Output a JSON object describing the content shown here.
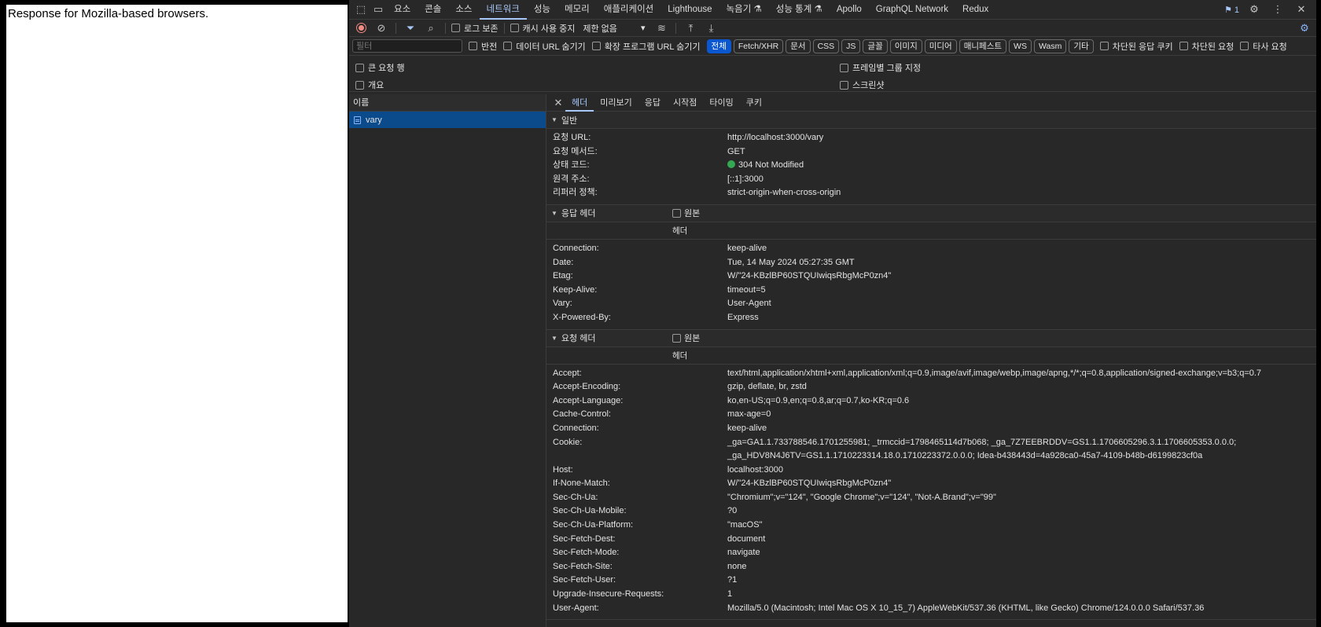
{
  "page": {
    "text": "Response for Mozilla-based browsers."
  },
  "tabs": [
    "요소",
    "콘솔",
    "소스",
    "네트워크",
    "성능",
    "메모리",
    "애플리케이션",
    "Lighthouse",
    "녹음기 ⚗",
    "성능 통계 ⚗",
    "Apollo",
    "GraphQL Network",
    "Redux"
  ],
  "active_tab": "네트워크",
  "issues_badge": "1",
  "toolbar": {
    "preserve_log": "로그 보존",
    "disable_cache": "캐시 사용 중지",
    "throttle": "제한 없음"
  },
  "filter": {
    "placeholder": "필터",
    "invert": "반전",
    "hide_data_urls": "데이터 URL 숨기기",
    "hide_ext_urls": "확장 프로그램 URL 숨기기",
    "types": [
      "전체",
      "Fetch/XHR",
      "문서",
      "CSS",
      "JS",
      "글꼴",
      "이미지",
      "미디어",
      "매니페스트",
      "WS",
      "Wasm",
      "기타"
    ],
    "blocked_cookies": "차단된 응답 쿠키",
    "blocked_requests": "차단된 요청",
    "third_party": "타사 요청"
  },
  "options": {
    "big_rows": "큰 요청 행",
    "group_by_frame": "프레임별 그룹 지정",
    "overview": "개요",
    "screenshots": "스크린샷"
  },
  "namelist": {
    "header": "이름",
    "items": [
      "vary"
    ]
  },
  "detail_tabs": [
    "헤더",
    "미리보기",
    "응답",
    "시작점",
    "타이밍",
    "쿠키"
  ],
  "general": {
    "title": "일반",
    "rows": [
      {
        "k": "요청 URL:",
        "v": "http://localhost:3000/vary"
      },
      {
        "k": "요청 메서드:",
        "v": "GET"
      },
      {
        "k": "상태 코드:",
        "v": "304 Not Modified"
      },
      {
        "k": "원격 주소:",
        "v": "[::1]:3000"
      },
      {
        "k": "리퍼러 정책:",
        "v": "strict-origin-when-cross-origin"
      }
    ]
  },
  "response_headers": {
    "title": "응답 헤더",
    "raw_label": "원본",
    "sub": "헤더",
    "rows": [
      {
        "k": "Connection:",
        "v": "keep-alive"
      },
      {
        "k": "Date:",
        "v": "Tue, 14 May 2024 05:27:35 GMT"
      },
      {
        "k": "Etag:",
        "v": "W/\"24-KBzlBP60STQUIwiqsRbgMcP0zn4\""
      },
      {
        "k": "Keep-Alive:",
        "v": "timeout=5"
      },
      {
        "k": "Vary:",
        "v": "User-Agent"
      },
      {
        "k": "X-Powered-By:",
        "v": "Express"
      }
    ]
  },
  "request_headers": {
    "title": "요청 헤더",
    "raw_label": "원본",
    "sub": "헤더",
    "rows": [
      {
        "k": "Accept:",
        "v": "text/html,application/xhtml+xml,application/xml;q=0.9,image/avif,image/webp,image/apng,*/*;q=0.8,application/signed-exchange;v=b3;q=0.7"
      },
      {
        "k": "Accept-Encoding:",
        "v": "gzip, deflate, br, zstd"
      },
      {
        "k": "Accept-Language:",
        "v": "ko,en-US;q=0.9,en;q=0.8,ar;q=0.7,ko-KR;q=0.6"
      },
      {
        "k": "Cache-Control:",
        "v": "max-age=0"
      },
      {
        "k": "Connection:",
        "v": "keep-alive"
      },
      {
        "k": "Cookie:",
        "v": "_ga=GA1.1.733788546.1701255981; _trmccid=1798465114d7b068; _ga_7Z7EEBRDDV=GS1.1.1706605296.3.1.1706605353.0.0.0;"
      },
      {
        "k": "",
        "v": "_ga_HDV8N4J6TV=GS1.1.1710223314.18.0.1710223372.0.0.0; Idea-b438443d=4a928ca0-45a7-4109-b48b-d6199823cf0a"
      },
      {
        "k": "Host:",
        "v": "localhost:3000"
      },
      {
        "k": "If-None-Match:",
        "v": "W/\"24-KBzlBP60STQUIwiqsRbgMcP0zn4\""
      },
      {
        "k": "Sec-Ch-Ua:",
        "v": "\"Chromium\";v=\"124\", \"Google Chrome\";v=\"124\", \"Not-A.Brand\";v=\"99\""
      },
      {
        "k": "Sec-Ch-Ua-Mobile:",
        "v": "?0"
      },
      {
        "k": "Sec-Ch-Ua-Platform:",
        "v": "\"macOS\""
      },
      {
        "k": "Sec-Fetch-Dest:",
        "v": "document"
      },
      {
        "k": "Sec-Fetch-Mode:",
        "v": "navigate"
      },
      {
        "k": "Sec-Fetch-Site:",
        "v": "none"
      },
      {
        "k": "Sec-Fetch-User:",
        "v": "?1"
      },
      {
        "k": "Upgrade-Insecure-Requests:",
        "v": "1"
      },
      {
        "k": "User-Agent:",
        "v": "Mozilla/5.0 (Macintosh; Intel Mac OS X 10_15_7) AppleWebKit/537.36 (KHTML, like Gecko) Chrome/124.0.0.0 Safari/537.36"
      }
    ]
  },
  "colors": {
    "accent": "#a8c7fa",
    "selected_row": "#0b4a8b",
    "status_ok": "#34a853",
    "record": "#f28b82"
  }
}
